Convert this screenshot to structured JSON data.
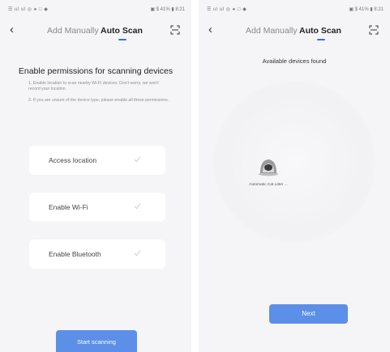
{
  "status": {
    "left": "☰ ul ul ◎ ● □ ◆",
    "right": "▣ $ 41% ▮ 8:21"
  },
  "left_screen": {
    "nav": {
      "tab_manual": "Add Manually",
      "tab_auto": "Auto Scan"
    },
    "title": "Enable permissions for scanning devices",
    "note1": "1. Enable location to scan nearby Wi-Fi devices. Don't worry, we won't record your location.",
    "note2": "2. If you are unsure of the device type, please enable all these permissions.",
    "permissions": [
      {
        "label": "Access location"
      },
      {
        "label": "Enable Wi-Fi"
      },
      {
        "label": "Enable Bluetooth"
      }
    ],
    "start_button": "Start scanning"
  },
  "right_screen": {
    "nav": {
      "tab_manual": "Add Manually",
      "tab_auto": "Auto Scan"
    },
    "title": "Available devices found",
    "device": {
      "name": "Automatic Cat Litter ..."
    },
    "next_button": "Next"
  },
  "colors": {
    "accent": "#3b6fd8",
    "button": "#5b8fe8",
    "background": "#f5f5f7"
  }
}
